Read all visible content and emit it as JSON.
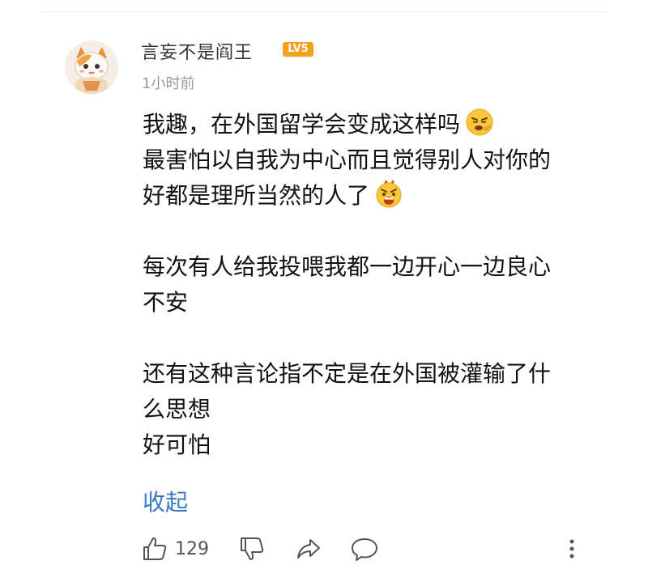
{
  "comment": {
    "user": {
      "name": "言妄不是阎王",
      "level_badge": "LV5",
      "avatar_icon": "cartoon-cat-avatar"
    },
    "timestamp": "1小时前",
    "lines": [
      {
        "text": "我趣，在外国留学会变成这样吗",
        "emoji": "spitting-face-emoji"
      },
      {
        "text": "最害怕以自我为中心而且觉得别人对你的"
      },
      {
        "text": "好都是理所当然的人了",
        "emoji": "angry-shouting-emoji"
      },
      {
        "text": ""
      },
      {
        "text": "每次有人给我投喂我都一边开心一边良心"
      },
      {
        "text": "不安"
      },
      {
        "text": ""
      },
      {
        "text": "还有这种言论指不定是在外国被灌输了什"
      },
      {
        "text": "么思想"
      },
      {
        "text": "好可怕"
      }
    ],
    "collapse_label": "收起",
    "actions": {
      "like_count": "129",
      "like_icon": "thumbs-up-icon",
      "dislike_icon": "thumbs-down-icon",
      "share_icon": "share-arrow-icon",
      "reply_icon": "comment-bubble-icon",
      "more_icon": "more-vertical-icon"
    },
    "colors": {
      "link": "#3b77c9",
      "badge": "#f3a21d",
      "meta": "#9a9a9a"
    }
  }
}
